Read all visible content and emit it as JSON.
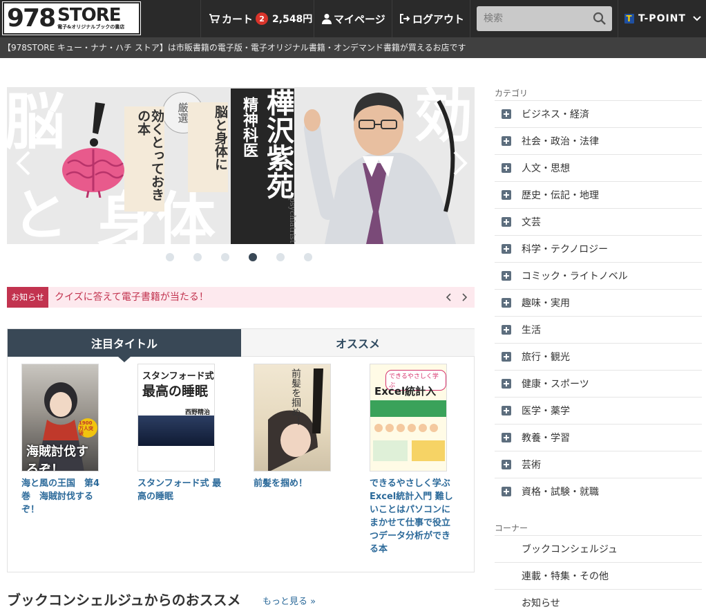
{
  "header": {
    "logo_number": "978",
    "logo_store": "STORE",
    "logo_sub": "電子&オリジナルブックの書店",
    "cart_label": "カート",
    "cart_count": "2",
    "cart_total": "2,548円",
    "mypage_label": "マイページ",
    "logout_label": "ログアウト",
    "search_placeholder": "検索",
    "tpoint_label": "T-POINT"
  },
  "tagline": "【978STORE キュー・ナナ・ハチ ストア】は市販書籍の電子版・電子オリジナル書籍・オンデマンド書籍が買えるお店です",
  "hero": {
    "badge": "厳選",
    "card1": "効くとっておきの本",
    "card2": "脳と身体に",
    "title_small": "精神科医",
    "title_name": "樺沢紫苑",
    "romaji": "psychiatrist Shion Kabasawa",
    "bg_text1": "脳",
    "bg_text2": "と",
    "bg_text3": "身体",
    "bg_text4": "効",
    "slide_count": 6,
    "active_slide": 4
  },
  "notice": {
    "label": "お知らせ",
    "text": "クイズに答えて電子書籍が当たる！"
  },
  "tabs": [
    {
      "label": "注目タイトル",
      "active": true
    },
    {
      "label": "オススメ",
      "active": false
    }
  ],
  "books": [
    {
      "title": "海と風の王国　第4巻　海賊討伐するぞ！",
      "cover_text": "海賊討伐するぞ！",
      "cover_badge": "1900万人突破"
    },
    {
      "title": "スタンフォード式 最高の睡眠",
      "cover_text1": "スタンフォード式",
      "cover_text2": "最高の睡眠",
      "cover_author": "西野精治"
    },
    {
      "title": "前髪を掴め！",
      "cover_text": "前髪を掴め！"
    },
    {
      "title": "できるやさしく学ぶ Excel統計入門 難しいことはパソコンにまかせて仕事で役立つデータ分析ができる本",
      "cover_text1": "できるやさしく学ぶ",
      "cover_text2": "Excel統計入門"
    }
  ],
  "section": {
    "title": "ブックコンシェルジュからのおススメ",
    "more": "もっと見る »"
  },
  "sidebar": {
    "category_heading": "カテゴリ",
    "categories": [
      "ビジネス・経済",
      "社会・政治・法律",
      "人文・思想",
      "歴史・伝記・地理",
      "文芸",
      "科学・テクノロジー",
      "コミック・ライトノベル",
      "趣味・実用",
      "生活",
      "旅行・観光",
      "健康・スポーツ",
      "医学・薬学",
      "教養・学習",
      "芸術",
      "資格・試験・就職"
    ],
    "corner_heading": "コーナー",
    "corners": [
      "ブックコンシェルジュ",
      "連載・特集・その他",
      "お知らせ"
    ]
  },
  "colors": {
    "header_bg": "#2a2a2a",
    "subbar_bg": "#404040",
    "tab_active": "#394856",
    "link": "#2c6a9a",
    "notice": "#c2334f",
    "badge": "#d9342b"
  }
}
